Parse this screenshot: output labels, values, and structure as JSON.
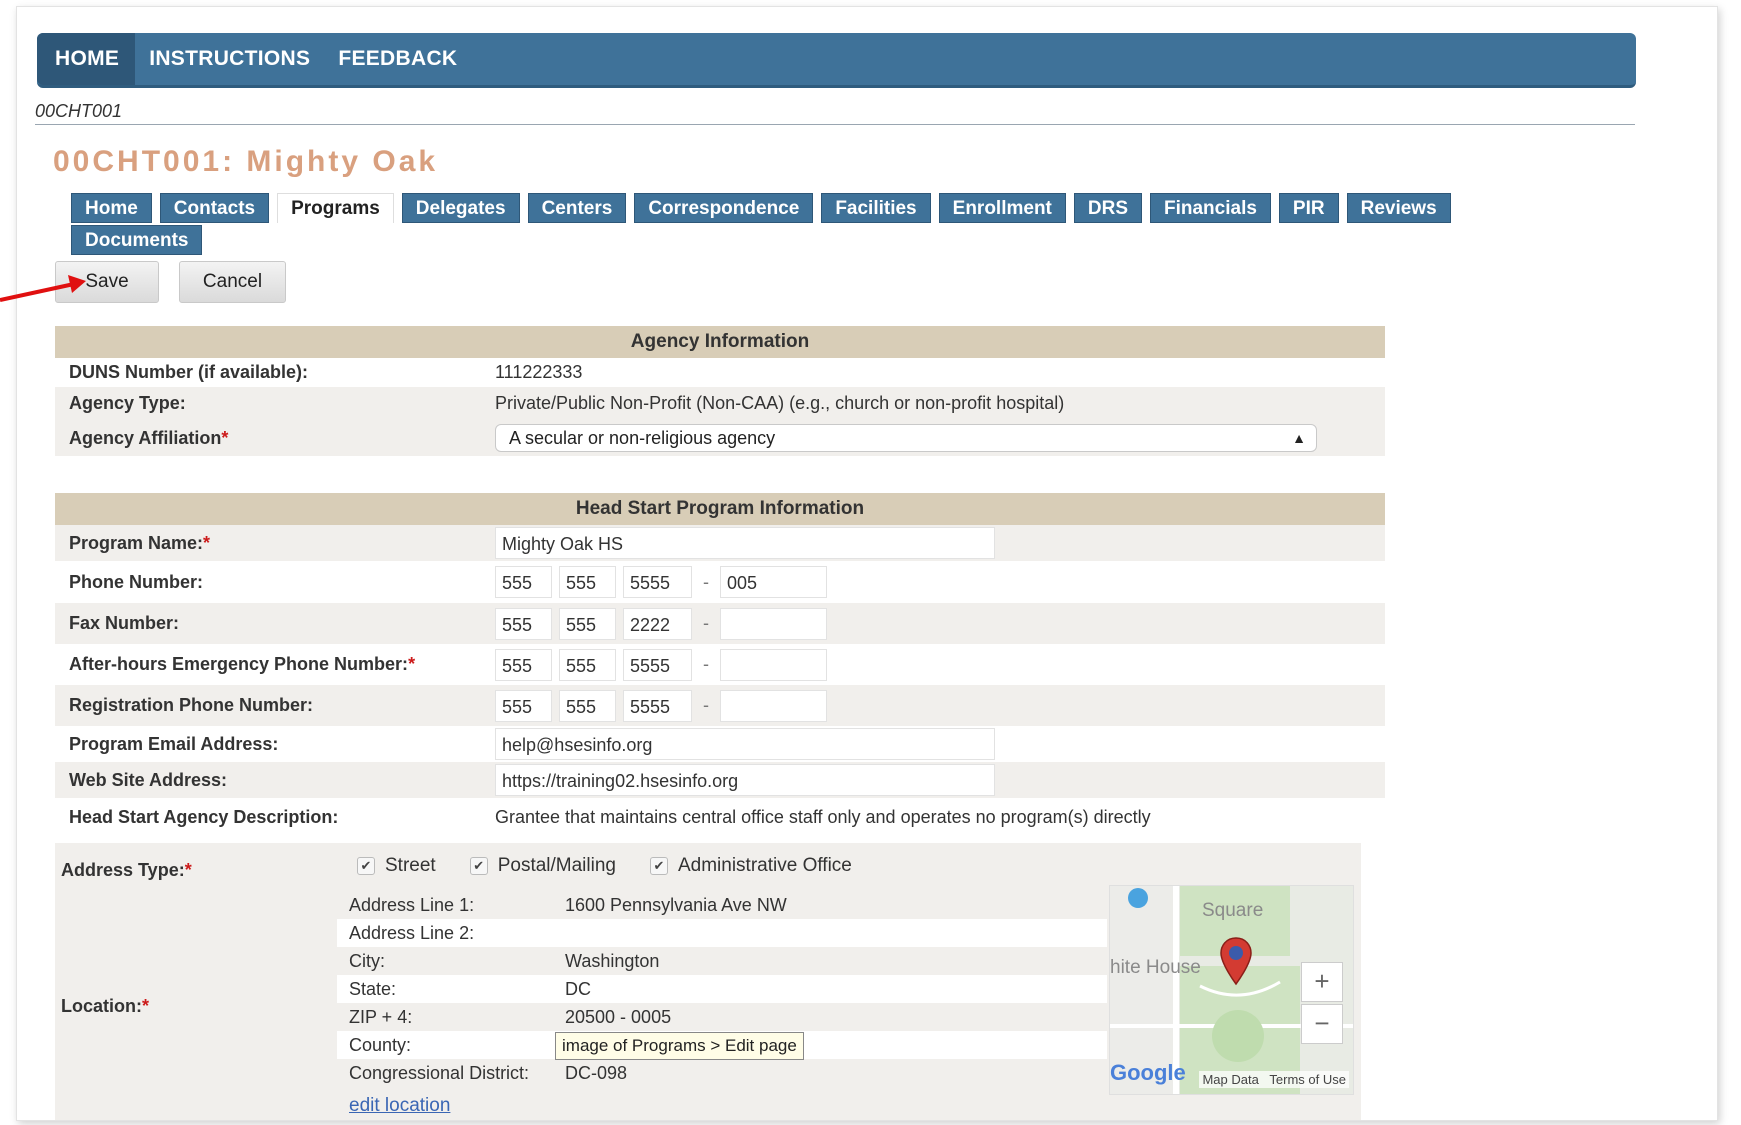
{
  "nav": {
    "items": [
      "HOME",
      "INSTRUCTIONS",
      "FEEDBACK"
    ]
  },
  "grant_id": "00CHT001",
  "page_title": "00CHT001: Mighty Oak",
  "tabs": {
    "row1": [
      "Home",
      "Contacts",
      "Programs",
      "Delegates",
      "Centers",
      "Correspondence",
      "Facilities",
      "Enrollment",
      "DRS",
      "Financials",
      "PIR",
      "Reviews"
    ],
    "row2": [
      "Documents"
    ],
    "active": "Programs"
  },
  "actions": {
    "save": "Save",
    "cancel": "Cancel"
  },
  "agency": {
    "header": "Agency Information",
    "duns_label": "DUNS Number (if available):",
    "duns_value": "111222333",
    "type_label": "Agency Type:",
    "type_value": "Private/Public Non-Profit (Non-CAA) (e.g., church or non-profit hospital)",
    "affiliation_label": "Agency Affiliation",
    "affiliation_value": "A secular or non-religious agency"
  },
  "program": {
    "header": "Head Start Program Information",
    "name_label": "Program Name:",
    "name_value": "Mighty Oak HS",
    "phone_label": "Phone Number:",
    "phone": [
      "555",
      "555",
      "5555",
      "005"
    ],
    "fax_label": "Fax Number:",
    "fax": [
      "555",
      "555",
      "2222",
      ""
    ],
    "emergency_label": "After-hours Emergency Phone Number:",
    "emergency": [
      "555",
      "555",
      "5555",
      ""
    ],
    "registration_label": "Registration Phone Number:",
    "registration": [
      "555",
      "555",
      "5555",
      ""
    ],
    "email_label": "Program Email Address:",
    "email_value": "help@hsesinfo.org",
    "web_label": "Web Site Address:",
    "web_value": "https://training02.hsesinfo.org",
    "description_label": "Head Start Agency Description:",
    "description_value": "Grantee that maintains central office staff only and operates no program(s) directly",
    "dash": "-"
  },
  "address": {
    "type_label": "Address Type:",
    "types": [
      "Street",
      "Postal/Mailing",
      "Administrative Office"
    ],
    "check_mark": "✔",
    "location_label": "Location:",
    "rows": [
      {
        "k": "Address Line 1:",
        "v": "1600 Pennsylvania Ave NW"
      },
      {
        "k": "Address Line 2:",
        "v": ""
      },
      {
        "k": "City:",
        "v": "Washington"
      },
      {
        "k": "State:",
        "v": "DC"
      },
      {
        "k": "ZIP + 4:",
        "v": "20500 - 0005"
      },
      {
        "k": "County:",
        "v": ""
      },
      {
        "k": "Congressional District:",
        "v": "DC-098"
      }
    ],
    "edit_link": "edit location",
    "tooltip": "image of Programs > Edit page"
  },
  "map": {
    "street_label": "Square",
    "landmark_label": "hite House",
    "zoom_in": "+",
    "zoom_out": "−",
    "logo": "Google",
    "map_data": "Map Data",
    "terms": "Terms of Use"
  },
  "colors": {
    "nav_bg": "#3f7299",
    "title": "#d9a07f",
    "section_header": "#d8cdb7",
    "required": "#cc1a1a",
    "annotation_arrow": "#e01010"
  }
}
